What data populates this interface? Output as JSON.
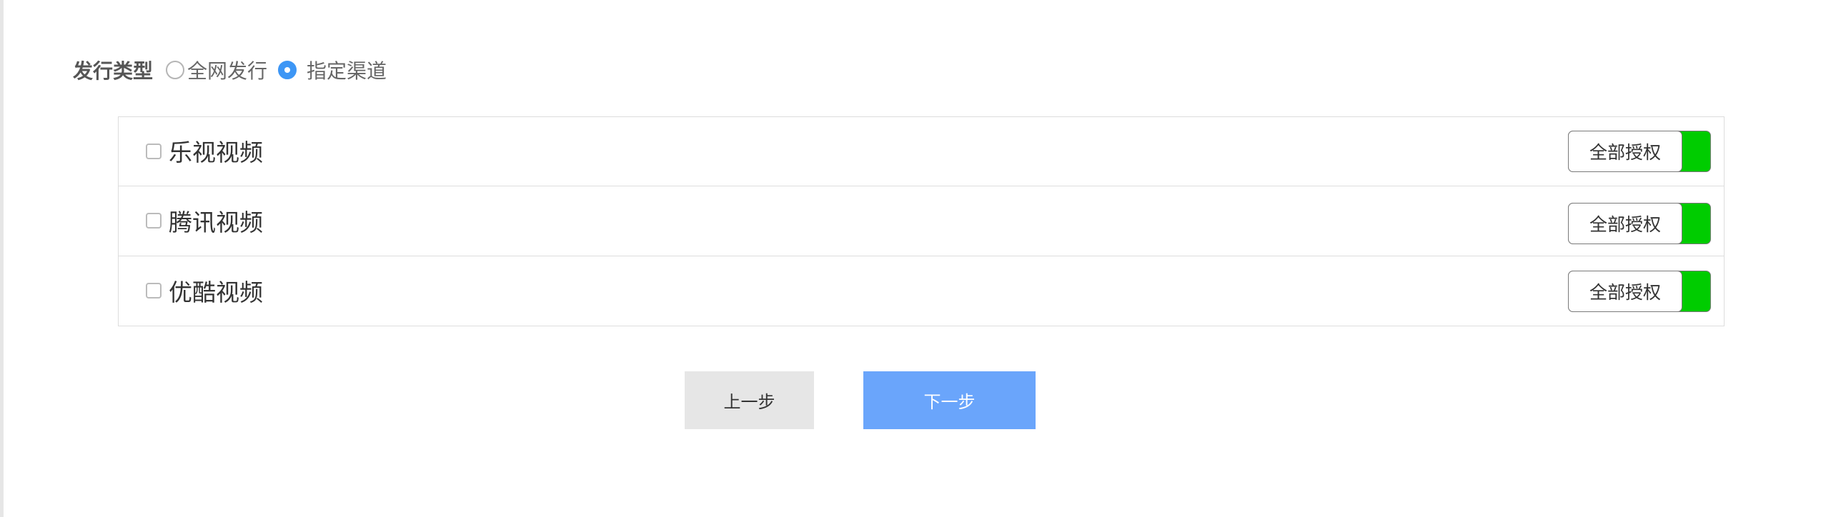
{
  "release_type": {
    "label": "发行类型",
    "options": [
      {
        "label": "全网发行",
        "selected": false
      },
      {
        "label": "指定渠道",
        "selected": true
      }
    ]
  },
  "channels": [
    {
      "name": "乐视视频",
      "checked": false,
      "auth_label": "全部授权"
    },
    {
      "name": "腾讯视频",
      "checked": false,
      "auth_label": "全部授权"
    },
    {
      "name": "优酷视频",
      "checked": false,
      "auth_label": "全部授权"
    }
  ],
  "buttons": {
    "prev_label": "上一步",
    "next_label": "下一步"
  },
  "colors": {
    "accent": "#3d96f5",
    "toggle_on": "#00cc00",
    "next_button": "#6aa5fb",
    "prev_button": "#e6e6e6"
  }
}
